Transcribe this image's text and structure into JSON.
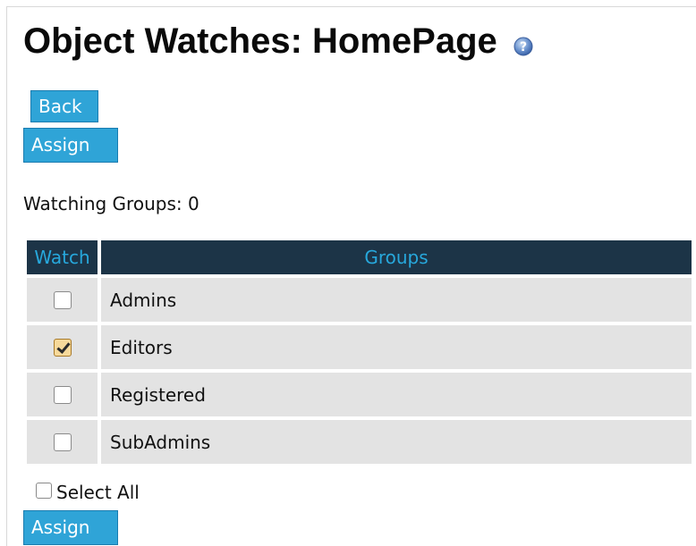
{
  "page": {
    "title": "Object Watches: HomePage",
    "help_icon": "help-question-icon"
  },
  "actions": {
    "back_label": "Back",
    "assign_label": "Assign"
  },
  "summary": {
    "watching_groups": "Watching Groups: 0"
  },
  "table": {
    "columns": [
      "Watch",
      "Groups"
    ],
    "rows": [
      {
        "group": "Admins",
        "watched": false
      },
      {
        "group": "Editors",
        "watched": true
      },
      {
        "group": "Registered",
        "watched": false
      },
      {
        "group": "SubAdmins",
        "watched": false
      }
    ]
  },
  "select_all": {
    "label": "Select All",
    "checked": false
  },
  "colors": {
    "button_bg": "#2fa4d7",
    "header_bg": "#1c3447",
    "header_text": "#27a8dc",
    "row_bg": "#e3e3e3"
  }
}
